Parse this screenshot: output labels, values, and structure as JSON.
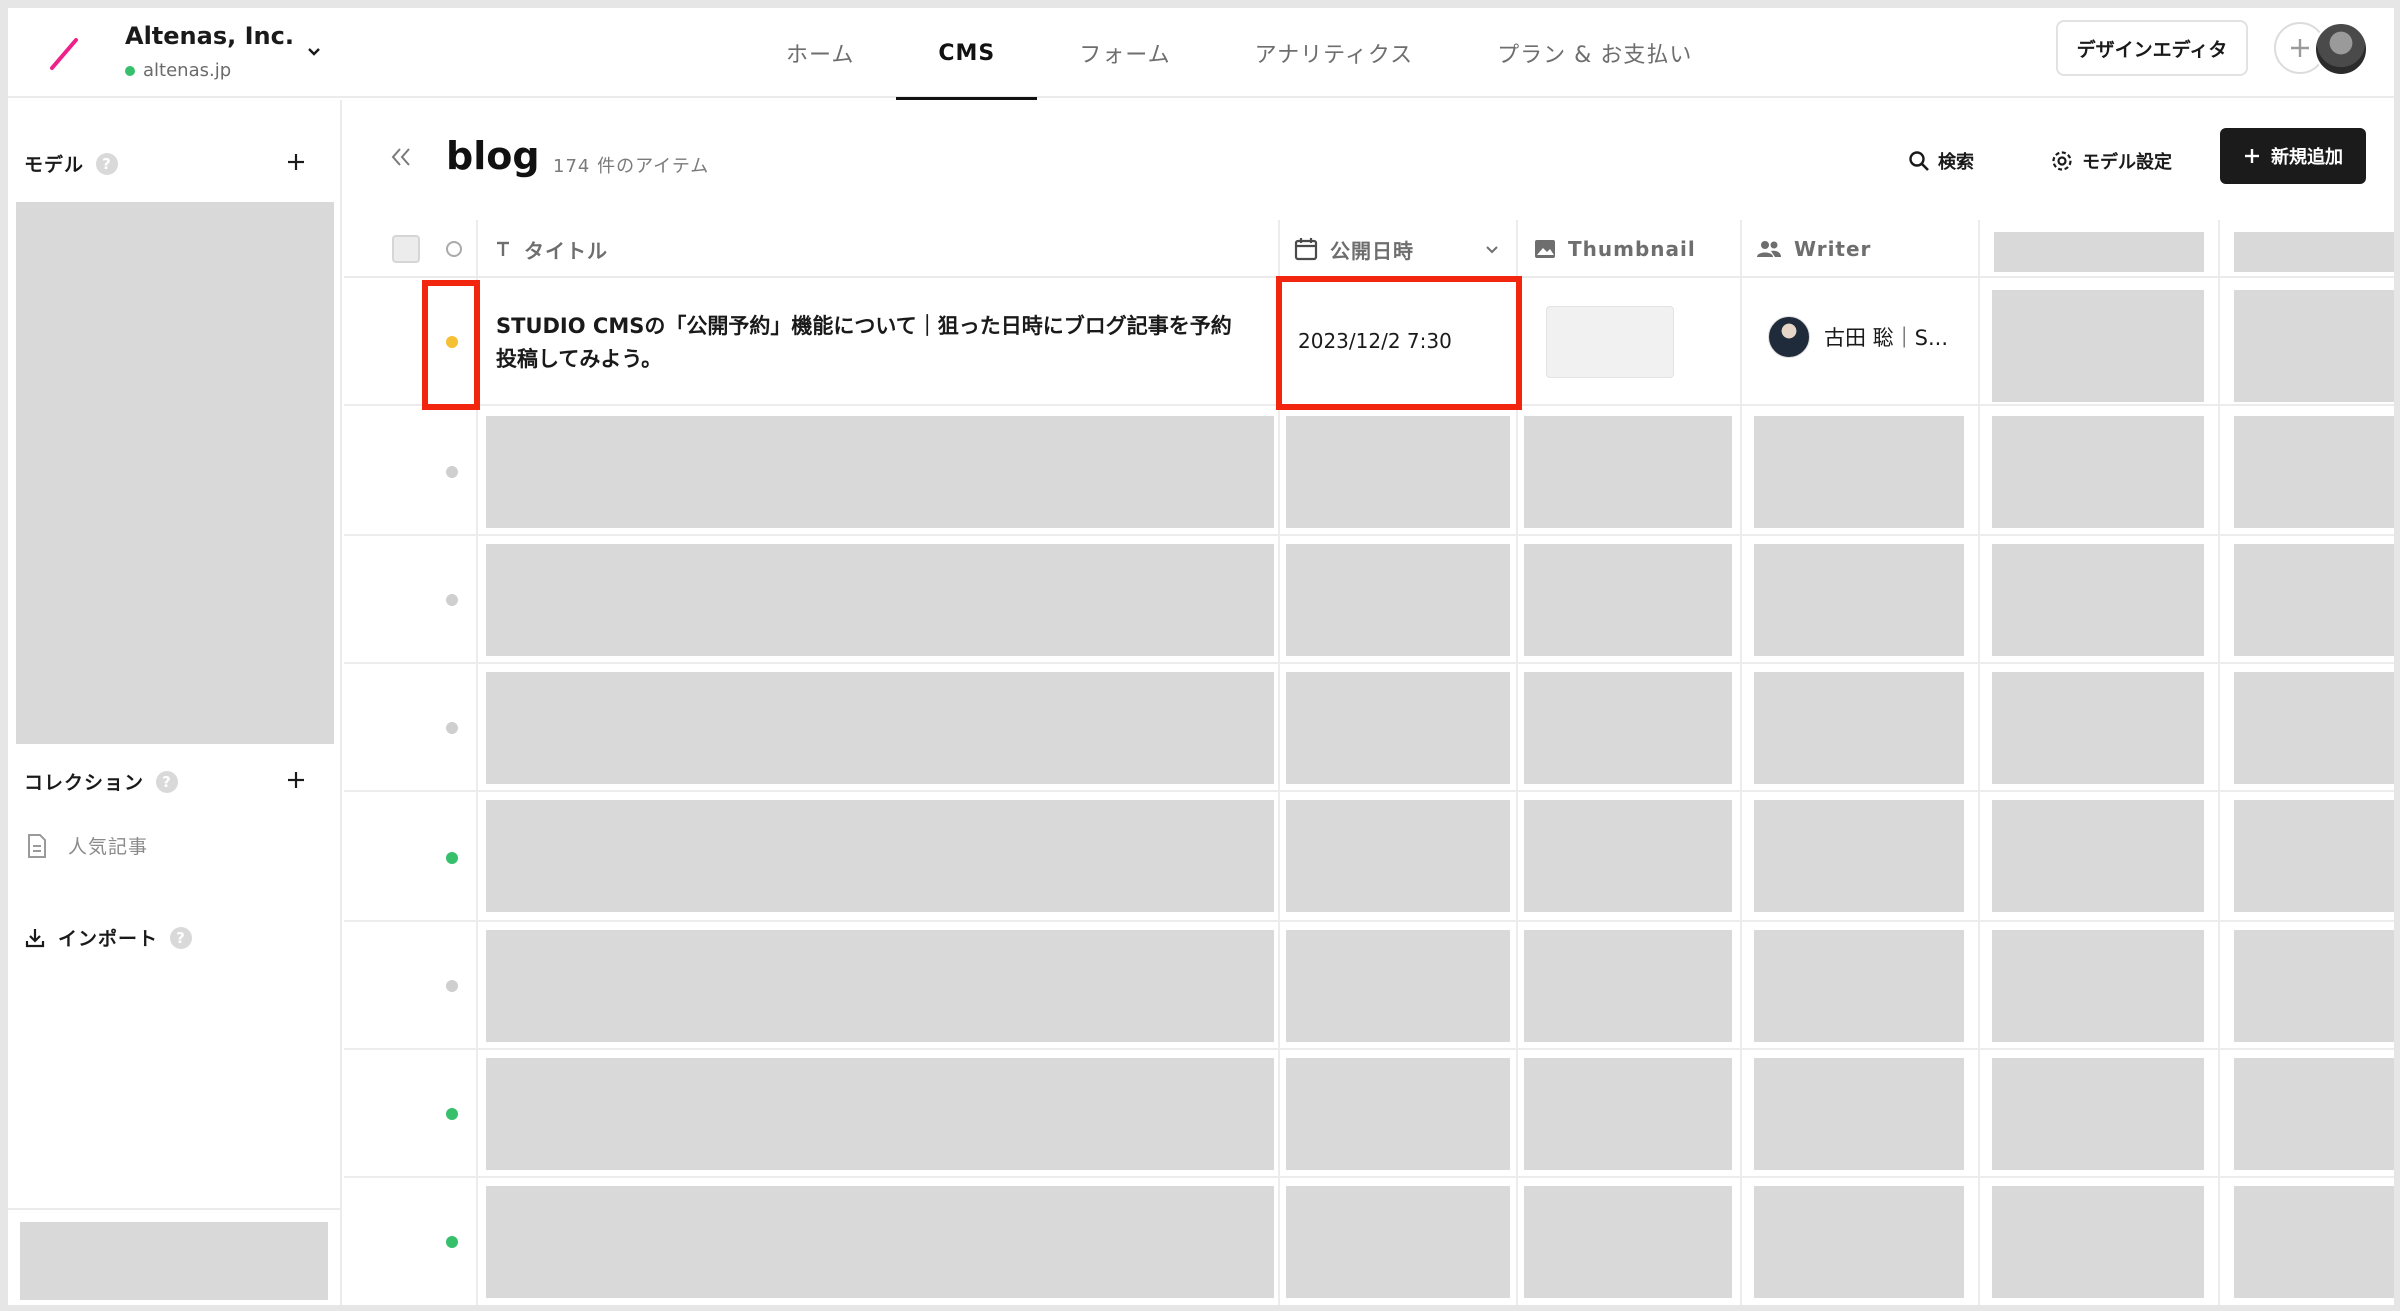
{
  "org": {
    "name": "Altenas, Inc.",
    "domain": "altenas.jp"
  },
  "nav": {
    "items": [
      "ホーム",
      "CMS",
      "フォーム",
      "アナリティクス",
      "プラン & お支払い"
    ],
    "active": "CMS"
  },
  "header_actions": {
    "design_editor": "デザインエディタ"
  },
  "sidebar": {
    "models_label": "モデル",
    "collections_label": "コレクション",
    "collection_items": [
      "人気記事"
    ],
    "import_label": "インポート",
    "help_glyph": "?"
  },
  "page": {
    "title": "blog",
    "item_count": "174 件のアイテム",
    "search_label": "検索",
    "model_settings_label": "モデル設定",
    "new_label": "新規追加"
  },
  "table": {
    "columns": {
      "title": "タイトル",
      "published": "公開日時",
      "thumbnail": "Thumbnail",
      "writer": "Writer"
    },
    "first_row": {
      "status": "scheduled",
      "title": "STUDIO CMSの「公開予約」機能について｜狙った日時にブログ記事を予約投稿してみよう。",
      "published": "2023/12/2 7:30",
      "writer": "古田 聡｜S..."
    },
    "row_statuses": [
      "draft",
      "draft",
      "draft",
      "published",
      "draft",
      "published",
      "published"
    ]
  },
  "colors": {
    "scheduled": "#f5c033",
    "published": "#37c06b",
    "draft": "#cfcfcf",
    "highlight": "#f2260e",
    "logo": "#f0208a"
  }
}
